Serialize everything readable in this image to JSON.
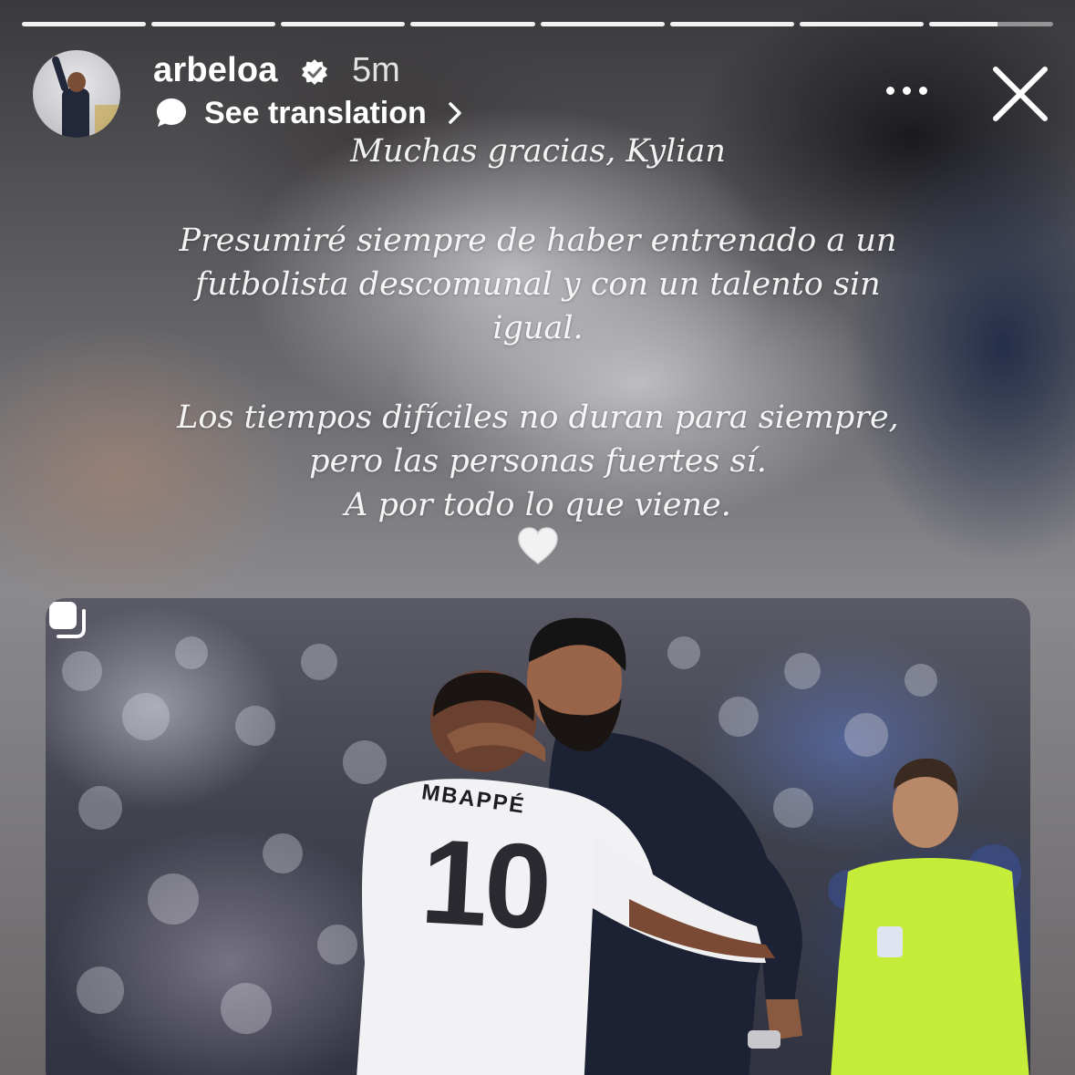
{
  "story": {
    "progress_segments": [
      1,
      1,
      1,
      1,
      1,
      1,
      1,
      0.55
    ],
    "user": {
      "username": "arbeloa",
      "time_ago": "5m",
      "verified": true
    },
    "see_translation_label": "See translation",
    "caption": {
      "line1": "Muchas gracias, Kylian",
      "para2_line1": "Presumiré siempre de haber entrenado a un",
      "para2_line2": "futbolista descomunal y con un talento sin",
      "para2_line3": "igual.",
      "para3_line1": "Los tiempos difíciles no duran para siempre,",
      "para3_line2": "pero las personas fuertes sí.",
      "para3_line3": "A por todo lo que viene.",
      "emoji": "white-heart"
    },
    "photo": {
      "jersey_name": "MBAPPÉ",
      "jersey_number": "10"
    }
  },
  "icons": {
    "more": "more-options-icon",
    "close": "close-icon",
    "translate": "translate-bubble-icon",
    "chevron": "chevron-right-icon",
    "verified": "verified-badge-icon",
    "repost": "reshared-post-icon",
    "heart": "white-heart-icon"
  },
  "colors": {
    "text_primary": "#ffffff",
    "referee_kit": "#c6ec3a",
    "coach_shirt": "#1c2233"
  }
}
